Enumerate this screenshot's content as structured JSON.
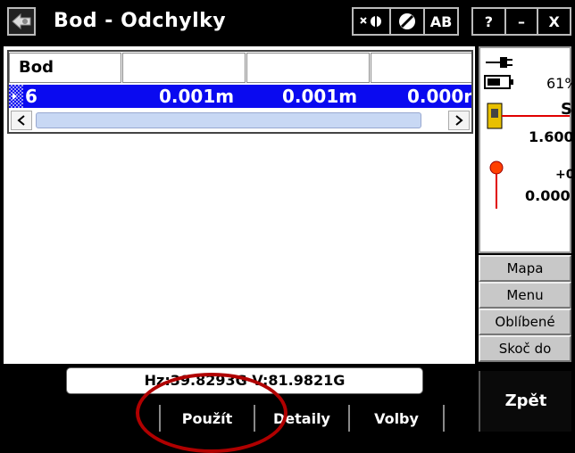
{
  "window": {
    "title": "Bod - Odchylky"
  },
  "titlebar": {
    "ab_label": "AB",
    "help_label": "?",
    "min_label": "–",
    "close_label": "X"
  },
  "table": {
    "columns": [
      "Bod",
      "",
      "",
      ""
    ],
    "rows": [
      {
        "cells": [
          "6",
          "0.001m",
          "0.001m",
          "0.000r"
        ]
      }
    ]
  },
  "status": {
    "battery_percent": "61%",
    "instrument_label": "S",
    "instrument_height": "1.600",
    "target_label": "+0",
    "target_height": "0.000"
  },
  "side_menu": [
    "Mapa",
    "Menu",
    "Oblíbené",
    "Skoč do"
  ],
  "angles": {
    "text": "Hz:39.8293G  V:81.9821G"
  },
  "softkeys": [
    "Použít",
    "Detaily",
    "Volby"
  ],
  "back_button": "Zpět",
  "colors": {
    "selection": "#0a0af0",
    "annotation": "#b00000"
  }
}
